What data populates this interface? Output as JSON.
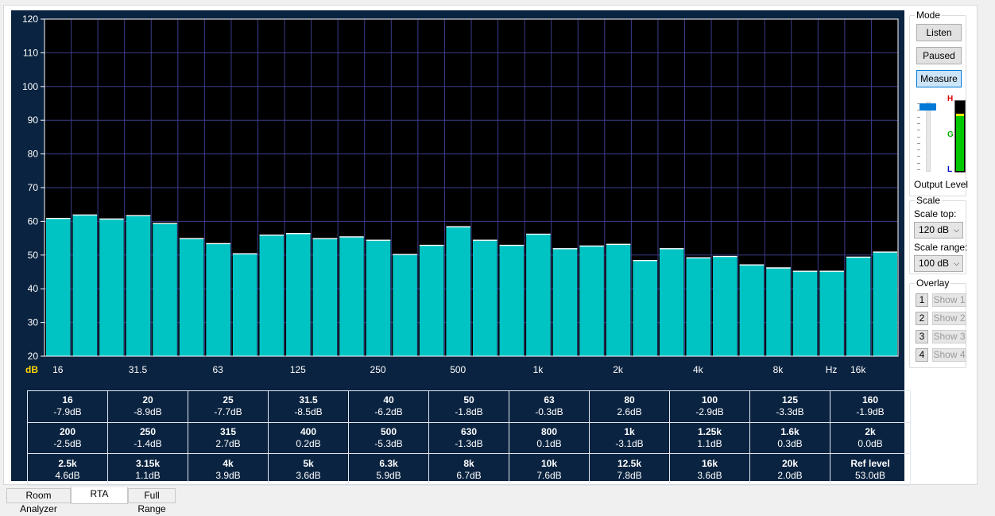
{
  "chart_data": {
    "type": "bar",
    "y_axis_unit": "dB",
    "x_axis_unit": "Hz",
    "ylim": [
      20,
      120
    ],
    "y_ticks": [
      20,
      30,
      40,
      50,
      60,
      70,
      80,
      90,
      100,
      110,
      120
    ],
    "x_tick_labels": [
      "16",
      "31.5",
      "63",
      "125",
      "250",
      "500",
      "1k",
      "2k",
      "4k",
      "8k",
      "16k"
    ],
    "grid": true,
    "values": [
      61,
      62,
      60.8,
      61.8,
      59.5,
      55,
      53.5,
      50.5,
      56,
      56.5,
      55,
      55.5,
      54.5,
      50.3,
      53,
      58.5,
      54.5,
      53,
      56.3,
      52,
      52.8,
      53.3,
      48.5,
      52,
      49.3,
      49.7,
      47.2,
      46.3,
      45.3,
      45.3,
      49.5,
      51
    ],
    "bar_color": "#00c4c4",
    "background_color": "#000000"
  },
  "bands": [
    [
      {
        "f": "16",
        "v": "-7.9dB"
      },
      {
        "f": "20",
        "v": "-8.9dB"
      },
      {
        "f": "25",
        "v": "-7.7dB"
      },
      {
        "f": "31.5",
        "v": "-8.5dB"
      },
      {
        "f": "40",
        "v": "-6.2dB"
      },
      {
        "f": "50",
        "v": "-1.8dB"
      },
      {
        "f": "63",
        "v": "-0.3dB"
      },
      {
        "f": "80",
        "v": "2.6dB"
      },
      {
        "f": "100",
        "v": "-2.9dB"
      },
      {
        "f": "125",
        "v": "-3.3dB"
      },
      {
        "f": "160",
        "v": "-1.9dB"
      }
    ],
    [
      {
        "f": "200",
        "v": "-2.5dB"
      },
      {
        "f": "250",
        "v": "-1.4dB"
      },
      {
        "f": "315",
        "v": "2.7dB"
      },
      {
        "f": "400",
        "v": "0.2dB"
      },
      {
        "f": "500",
        "v": "-5.3dB"
      },
      {
        "f": "630",
        "v": "-1.3dB"
      },
      {
        "f": "800",
        "v": "0.1dB"
      },
      {
        "f": "1k",
        "v": "-3.1dB"
      },
      {
        "f": "1.25k",
        "v": "1.1dB"
      },
      {
        "f": "1.6k",
        "v": "0.3dB"
      },
      {
        "f": "2k",
        "v": "0.0dB"
      }
    ],
    [
      {
        "f": "2.5k",
        "v": "4.6dB"
      },
      {
        "f": "3.15k",
        "v": "1.1dB"
      },
      {
        "f": "4k",
        "v": "3.9dB"
      },
      {
        "f": "5k",
        "v": "3.6dB"
      },
      {
        "f": "6.3k",
        "v": "5.9dB"
      },
      {
        "f": "8k",
        "v": "6.7dB"
      },
      {
        "f": "10k",
        "v": "7.6dB"
      },
      {
        "f": "12.5k",
        "v": "7.8dB"
      },
      {
        "f": "16k",
        "v": "3.6dB"
      },
      {
        "f": "20k",
        "v": "2.0dB"
      },
      {
        "f": "Ref level",
        "v": "53.0dB"
      }
    ]
  ],
  "mode": {
    "legend": "Mode",
    "listen": "Listen",
    "paused": "Paused",
    "measure": "Measure",
    "active": "measure",
    "output_label": "Output Level",
    "meter_labels": {
      "high": "H",
      "good": "G",
      "low": "L"
    },
    "meter_level_fraction": 0.82,
    "slider_fraction": 0.97
  },
  "scale": {
    "legend": "Scale",
    "top_label": "Scale top:",
    "top_value": "120 dB",
    "range_label": "Scale range:",
    "range_value": "100 dB"
  },
  "overlay": {
    "legend": "Overlay",
    "items": [
      {
        "num": "1",
        "show": "Show 1"
      },
      {
        "num": "2",
        "show": "Show 2"
      },
      {
        "num": "3",
        "show": "Show 3"
      },
      {
        "num": "4",
        "show": "Show 4"
      }
    ]
  },
  "tabs": [
    {
      "label": "Room Analyzer",
      "active": false
    },
    {
      "label": "RTA",
      "active": true
    },
    {
      "label": "Full Range",
      "active": false
    }
  ],
  "colors": {
    "panel": "#0a2340",
    "grid": "#3c3c8c",
    "meter_green": "#00c800",
    "meter_marker": "#ffee00",
    "active_button": "#cce4f7"
  }
}
